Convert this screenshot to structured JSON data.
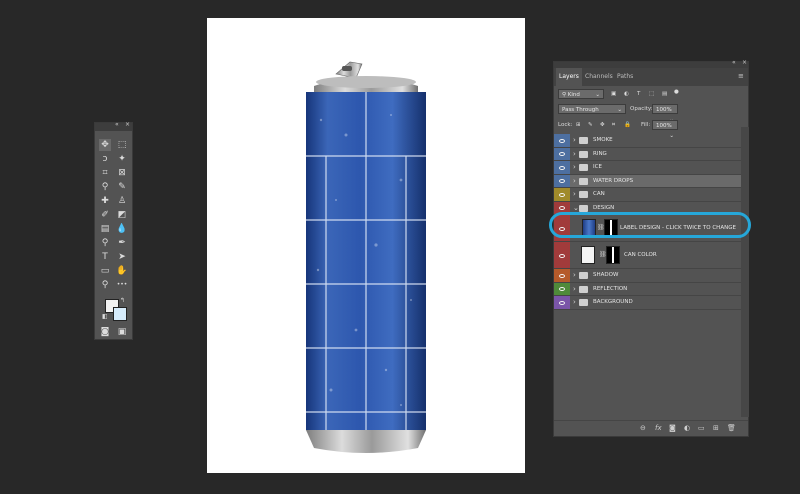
{
  "tools_panel": {
    "collapse_label": "«",
    "close_label": "×",
    "icons": [
      "move-icon",
      "marquee-icon",
      "lasso-icon",
      "magic-wand-icon",
      "crop-icon",
      "frame-icon",
      "eyedropper-icon",
      "ruler-icon",
      "healing-brush-icon",
      "stamp-icon",
      "brush-icon",
      "eraser-icon",
      "gradient-icon",
      "blur-icon",
      "dodge-icon",
      "pen-icon",
      "type-icon",
      "path-select-icon",
      "rectangle-icon",
      "hand-icon",
      "zoom-icon",
      "more-tools-icon",
      "quick-mask-icon",
      "screen-mode-icon"
    ],
    "type_tool_glyph": "T",
    "more_glyph": "•••"
  },
  "layers_panel": {
    "collapse_label": "«",
    "close_label": "×",
    "tabs": [
      "Layers",
      "Channels",
      "Paths"
    ],
    "active_tab": "Layers",
    "menu_glyph": "≡",
    "filter_kind": "Kind",
    "blend_mode": "Pass Through",
    "opacity_label": "Opacity:",
    "opacity_value": "100%",
    "lock_label": "Lock:",
    "fill_label": "Fill:",
    "fill_value": "100%",
    "layers": [
      {
        "name": "SMOKE",
        "color": "#4d6fa0",
        "type": "group",
        "expanded": false,
        "selected": false
      },
      {
        "name": "RING",
        "color": "#4d6fa0",
        "type": "group",
        "expanded": false,
        "selected": false
      },
      {
        "name": "ICE",
        "color": "#4d6fa0",
        "type": "group",
        "expanded": false,
        "selected": false
      },
      {
        "name": "WATER DROPS",
        "color": "#4d6fa0",
        "type": "group",
        "expanded": false,
        "selected": true
      },
      {
        "name": "CAN",
        "color": "#a08a2a",
        "type": "group",
        "expanded": false,
        "selected": false
      },
      {
        "name": "DESIGN",
        "color": "#a13b3b",
        "type": "group",
        "expanded": true,
        "selected": false
      },
      {
        "name": "LABEL DESIGN - CLICK TWICE TO CHANGE",
        "color": "#a13b3b",
        "type": "smart",
        "selected": false
      },
      {
        "name": "CAN COLOR",
        "color": "#a13b3b",
        "type": "fill",
        "selected": false
      },
      {
        "name": "SHADOW",
        "color": "#b55a2a",
        "type": "group",
        "expanded": false,
        "selected": false
      },
      {
        "name": "REFLECTION",
        "color": "#4f8a3a",
        "type": "group",
        "expanded": false,
        "selected": false
      },
      {
        "name": "BACKGROUND",
        "color": "#7a55a8",
        "type": "group",
        "expanded": false,
        "selected": false
      }
    ],
    "footer_icons": [
      "link-icon",
      "fx-icon",
      "mask-icon",
      "adjustment-icon",
      "folder-icon",
      "new-layer-icon",
      "trash-icon"
    ],
    "footer_fx": "fx"
  },
  "colors": {
    "highlight": "#26a7d9",
    "background": "#282828",
    "panel": "#535353"
  }
}
